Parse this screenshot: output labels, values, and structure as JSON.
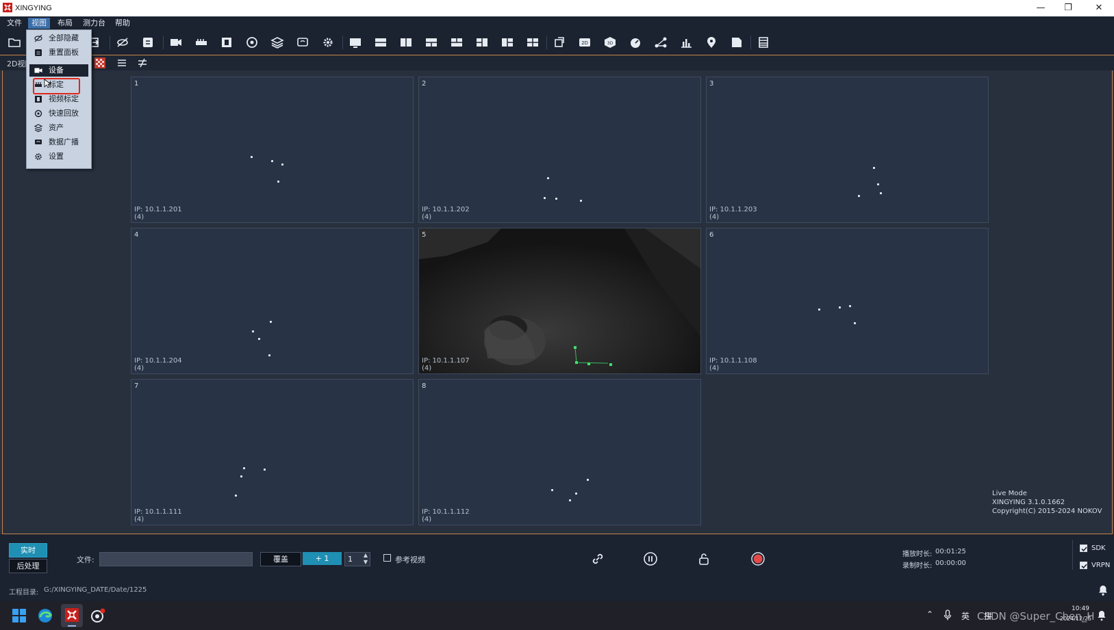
{
  "window": {
    "title": "XINGYING",
    "minimize": "—",
    "maximize": "❐",
    "close": "✕"
  },
  "menu": [
    "文件",
    "视图",
    "布局",
    "测力台",
    "帮助"
  ],
  "view_menu": {
    "items": [
      {
        "label": "全部隐藏",
        "icon": "eye-slash-icon"
      },
      {
        "label": "重置面板",
        "icon": "reset-panel-icon"
      },
      {
        "label": "设备",
        "icon": "camera-device-icon"
      },
      {
        "label": "标定",
        "icon": "calibration-icon"
      },
      {
        "label": "视频标定",
        "icon": "video-calibration-icon"
      },
      {
        "label": "快速回放",
        "icon": "replay-icon"
      },
      {
        "label": "资产",
        "icon": "layers-icon"
      },
      {
        "label": "数据广播",
        "icon": "broadcast-icon"
      },
      {
        "label": "设置",
        "icon": "gear-icon"
      }
    ]
  },
  "subbar": {
    "label": "2D视图"
  },
  "cameras": [
    {
      "num": "1",
      "ip": "IP: 10.1.1.201",
      "count": "(4)"
    },
    {
      "num": "2",
      "ip": "IP: 10.1.1.202",
      "count": "(4)"
    },
    {
      "num": "3",
      "ip": "IP: 10.1.1.203",
      "count": "(4)"
    },
    {
      "num": "4",
      "ip": "IP: 10.1.1.204",
      "count": "(4)"
    },
    {
      "num": "5",
      "ip": "IP: 10.1.1.107",
      "count": "(4)"
    },
    {
      "num": "6",
      "ip": "IP: 10.1.1.108",
      "count": "(4)"
    },
    {
      "num": "7",
      "ip": "IP: 10.1.1.111",
      "count": "(4)"
    },
    {
      "num": "8",
      "ip": "IP: 10.1.1.112",
      "count": "(4)"
    }
  ],
  "info": {
    "mode": "Live Mode",
    "version": "XINGYING 3.1.0.1662",
    "copyright": "Copyright(C) 2015-2024 NOKOV"
  },
  "bottom": {
    "realtime": "实时",
    "postprocess": "后处理",
    "file_label": "文件:",
    "file_value": "",
    "overwrite": "覆盖",
    "plus_one": "+ 1",
    "stepper_value": "1",
    "ref_video": "参考视频",
    "play_time_label": "播放时长:",
    "play_time": "00:01:25",
    "rec_time_label": "录制时长:",
    "rec_time": "00:00:00",
    "sdk": "SDK",
    "vrpn": "VRPN"
  },
  "status": {
    "project_label": "工程目录:",
    "project_path": "G:/XINGYING_DATE/Date/1225"
  },
  "taskbar": {
    "ime": "英",
    "ime2": "拼",
    "time": "10:49",
    "date": "2024/12/25",
    "watermark": "CSDN @Super_Chen_H"
  },
  "colors": {
    "accent": "#c8854a",
    "highlight_box": "#e0261c",
    "active_button": "#1f8fb3",
    "marker_green": "#3fe06a"
  }
}
